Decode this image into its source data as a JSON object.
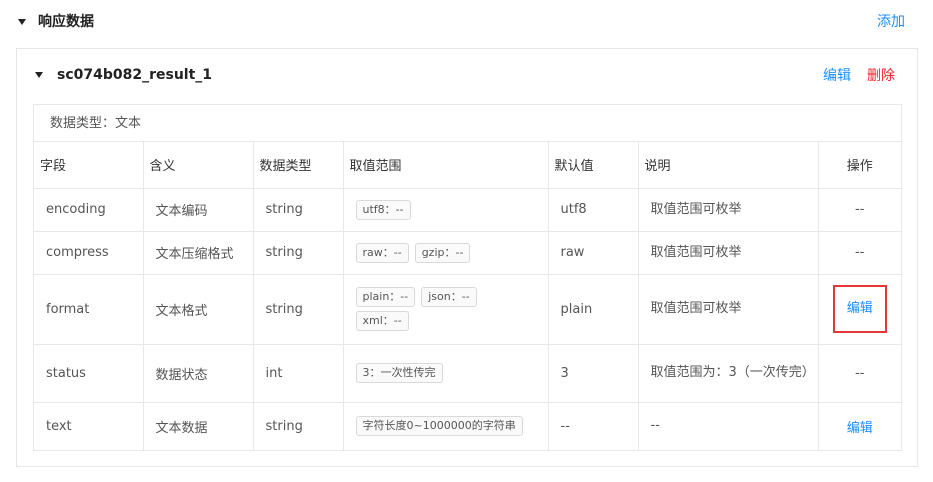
{
  "section": {
    "title": "响应数据",
    "add_label": "添加"
  },
  "card": {
    "title": "sc074b082_result_1",
    "edit_label": "编辑",
    "delete_label": "删除",
    "data_type_line": "数据类型：文本"
  },
  "table": {
    "headers": [
      "字段",
      "含义",
      "数据类型",
      "取值范围",
      "默认值",
      "说明",
      "操作"
    ],
    "rows": [
      {
        "field": "encoding",
        "meaning": "文本编码",
        "type": "string",
        "tags": [
          "utf8：--"
        ],
        "default": "utf8",
        "desc": "取值范围可枚举",
        "op": "--"
      },
      {
        "field": "compress",
        "meaning": "文本压缩格式",
        "type": "string",
        "tags": [
          "raw：--",
          "gzip：--"
        ],
        "default": "raw",
        "desc": "取值范围可枚举",
        "op": "--"
      },
      {
        "field": "format",
        "meaning": "文本格式",
        "type": "string",
        "tags": [
          "plain：--",
          "json：--",
          "xml：--"
        ],
        "default": "plain",
        "desc": "取值范围可枚举",
        "op": "编辑"
      },
      {
        "field": "status",
        "meaning": "数据状态",
        "type": "int",
        "tags": [
          "3：一次性传完"
        ],
        "default": "3",
        "desc": "取值范围为：3（一次传完）",
        "op": "--"
      },
      {
        "field": "text",
        "meaning": "文本数据",
        "type": "string",
        "tags": [
          "字符长度0~1000000的字符串"
        ],
        "default": "--",
        "desc": "--",
        "op": "编辑"
      }
    ]
  },
  "colors": {
    "accent": "#1890ff",
    "danger": "#f5222d",
    "highlight_border": "#e53935"
  },
  "icons": {
    "collapse": "caret-down-icon"
  }
}
